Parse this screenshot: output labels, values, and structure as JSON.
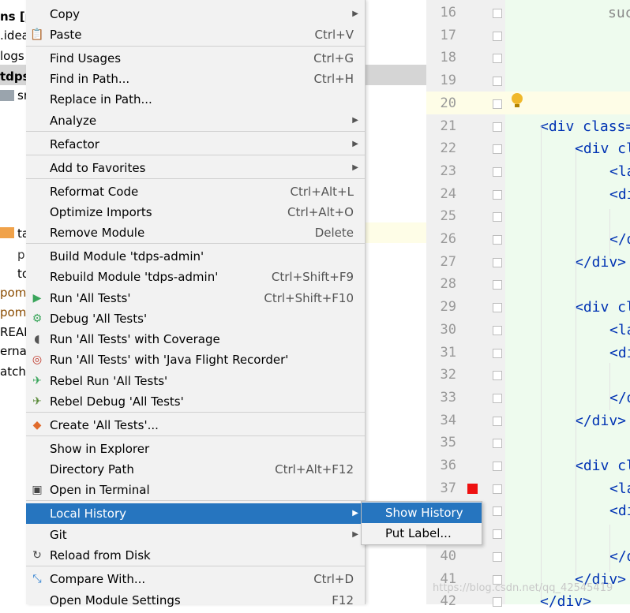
{
  "tree": {
    "items": [
      {
        "text": "ns [p"
      },
      {
        "text": ".idea"
      },
      {
        "text": "logs"
      },
      {
        "text": "tdps"
      },
      {
        "text": "sr"
      },
      {
        "text": "ta"
      },
      {
        "text": "p"
      },
      {
        "text": "to"
      },
      {
        "text": "pom"
      },
      {
        "text": "pom"
      },
      {
        "text": "REAI"
      },
      {
        "text": "erna"
      },
      {
        "text": "atch"
      }
    ]
  },
  "editor": {
    "line_numbers": [
      "16",
      "17",
      "18",
      "19",
      "20",
      "21",
      "22",
      "23",
      "24",
      "25",
      "26",
      "27",
      "28",
      "29",
      "30",
      "31",
      "32",
      "33",
      "34",
      "35",
      "36",
      "37",
      "38",
      "39",
      "40",
      "41",
      "42"
    ],
    "code_lines": [
      {
        "indent": 130,
        "text": "suc",
        "kind": "muted"
      },
      {
        "indent": 0,
        "text": "",
        "kind": "plain"
      },
      {
        "indent": 0,
        "text": "",
        "kind": "plain"
      },
      {
        "indent": 0,
        "text": "",
        "kind": "plain"
      },
      {
        "indent": 0,
        "text": "",
        "kind": "plain"
      },
      {
        "indent": 44,
        "text": "<div class=",
        "kind": "tag"
      },
      {
        "indent": 88,
        "text": "<div cl",
        "kind": "tag"
      },
      {
        "indent": 132,
        "text": "<la",
        "kind": "tag"
      },
      {
        "indent": 132,
        "text": "<di",
        "kind": "tag"
      },
      {
        "indent": 0,
        "text": "",
        "kind": "plain"
      },
      {
        "indent": 132,
        "text": "</d",
        "kind": "tag"
      },
      {
        "indent": 88,
        "text": "</div>",
        "kind": "tag"
      },
      {
        "indent": 0,
        "text": "",
        "kind": "plain"
      },
      {
        "indent": 88,
        "text": "<div cl",
        "kind": "tag"
      },
      {
        "indent": 132,
        "text": "<la",
        "kind": "tag"
      },
      {
        "indent": 132,
        "text": "<di",
        "kind": "tag"
      },
      {
        "indent": 0,
        "text": "",
        "kind": "plain"
      },
      {
        "indent": 132,
        "text": "</d",
        "kind": "tag"
      },
      {
        "indent": 88,
        "text": "</div>",
        "kind": "tag"
      },
      {
        "indent": 0,
        "text": "",
        "kind": "plain"
      },
      {
        "indent": 88,
        "text": "<div cl",
        "kind": "tag"
      },
      {
        "indent": 132,
        "text": "<la",
        "kind": "tag"
      },
      {
        "indent": 132,
        "text": "<di",
        "kind": "tag"
      },
      {
        "indent": 0,
        "text": "",
        "kind": "plain"
      },
      {
        "indent": 132,
        "text": "</d",
        "kind": "tag"
      },
      {
        "indent": 88,
        "text": "</div>",
        "kind": "tag"
      },
      {
        "indent": 44,
        "text": "</div>",
        "kind": "tag"
      }
    ],
    "watermark": "https://blog.csdn.net/qq_42545419"
  },
  "menu": {
    "items": [
      {
        "label": "Copy",
        "shortcut": "",
        "arrow": true,
        "icon": ""
      },
      {
        "label": "Paste",
        "shortcut": "Ctrl+V",
        "arrow": false,
        "icon": "paste-icon"
      },
      {
        "label": "Find Usages",
        "shortcut": "Ctrl+G",
        "arrow": false,
        "icon": ""
      },
      {
        "label": "Find in Path...",
        "shortcut": "Ctrl+H",
        "arrow": false,
        "icon": ""
      },
      {
        "label": "Replace in Path...",
        "shortcut": "",
        "arrow": false,
        "icon": ""
      },
      {
        "label": "Analyze",
        "shortcut": "",
        "arrow": true,
        "icon": ""
      },
      {
        "label": "Refactor",
        "shortcut": "",
        "arrow": true,
        "icon": ""
      },
      {
        "label": "Add to Favorites",
        "shortcut": "",
        "arrow": true,
        "icon": ""
      },
      {
        "label": "Reformat Code",
        "shortcut": "Ctrl+Alt+L",
        "arrow": false,
        "icon": ""
      },
      {
        "label": "Optimize Imports",
        "shortcut": "Ctrl+Alt+O",
        "arrow": false,
        "icon": ""
      },
      {
        "label": "Remove Module",
        "shortcut": "Delete",
        "arrow": false,
        "icon": ""
      },
      {
        "label": "Build Module 'tdps-admin'",
        "shortcut": "",
        "arrow": false,
        "icon": ""
      },
      {
        "label": "Rebuild Module 'tdps-admin'",
        "shortcut": "Ctrl+Shift+F9",
        "arrow": false,
        "icon": ""
      },
      {
        "label": "Run 'All Tests'",
        "shortcut": "Ctrl+Shift+F10",
        "arrow": false,
        "icon": "run-icon"
      },
      {
        "label": "Debug 'All Tests'",
        "shortcut": "",
        "arrow": false,
        "icon": "debug-icon"
      },
      {
        "label": "Run 'All Tests' with Coverage",
        "shortcut": "",
        "arrow": false,
        "icon": "coverage-icon"
      },
      {
        "label": "Run 'All Tests' with 'Java Flight Recorder'",
        "shortcut": "",
        "arrow": false,
        "icon": "profiler-icon"
      },
      {
        "label": "Rebel Run 'All Tests'",
        "shortcut": "",
        "arrow": false,
        "icon": "rebel-run-icon"
      },
      {
        "label": "Rebel Debug 'All Tests'",
        "shortcut": "",
        "arrow": false,
        "icon": "rebel-debug-icon"
      },
      {
        "label": "Create 'All Tests'...",
        "shortcut": "",
        "arrow": false,
        "icon": "create-config-icon"
      },
      {
        "label": "Show in Explorer",
        "shortcut": "",
        "arrow": false,
        "icon": ""
      },
      {
        "label": "Directory Path",
        "shortcut": "Ctrl+Alt+F12",
        "arrow": false,
        "icon": ""
      },
      {
        "label": "Open in Terminal",
        "shortcut": "",
        "arrow": false,
        "icon": "terminal-icon"
      },
      {
        "label": "Local History",
        "shortcut": "",
        "arrow": true,
        "icon": ""
      },
      {
        "label": "Git",
        "shortcut": "",
        "arrow": true,
        "icon": ""
      },
      {
        "label": "Reload from Disk",
        "shortcut": "",
        "arrow": false,
        "icon": "reload-icon"
      },
      {
        "label": "Compare With...",
        "shortcut": "Ctrl+D",
        "arrow": false,
        "icon": "compare-icon"
      },
      {
        "label": "Open Module Settings",
        "shortcut": "F12",
        "arrow": false,
        "icon": ""
      }
    ],
    "active_label": "Local History"
  },
  "submenu": {
    "items": [
      {
        "label": "Show History"
      },
      {
        "label": "Put Label..."
      }
    ]
  },
  "colors": {
    "menu_bg": "#f2f2f2",
    "selection": "#2675bf",
    "tag": "#0033b3",
    "breakpoint": "#ee1111"
  }
}
